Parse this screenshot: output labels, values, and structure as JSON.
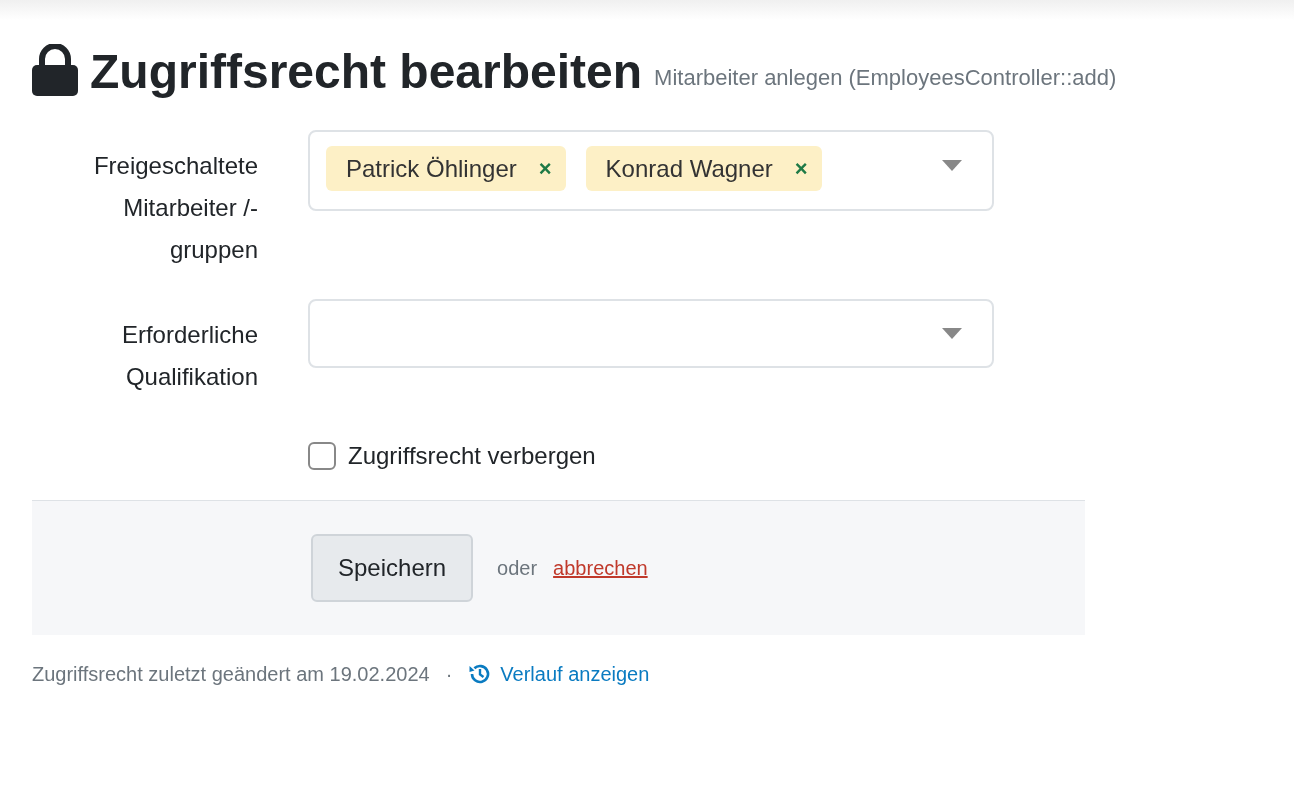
{
  "title": "Zugriffsrecht bearbeiten",
  "subtitle": "Mitarbeiter anlegen (EmployeesController::add)",
  "fields": [
    {
      "kind": "multiselect",
      "label": "Freigeschaltete Mitarbeiter /-gruppen",
      "tags": [
        {
          "text": "Patrick Öhlinger",
          "remove": "×"
        },
        {
          "text": "Konrad Wagner",
          "remove": "×"
        }
      ]
    },
    {
      "kind": "select",
      "label": "Erforderliche Qualifikation"
    }
  ],
  "checkbox": {
    "label": "Zugriffsrecht verbergen",
    "checked": false
  },
  "actions": {
    "save": "Speichern",
    "separator": "oder",
    "cancel": "abbrechen"
  },
  "footer": {
    "text": "Zugriffsrecht zuletzt geändert am 19.02.2024",
    "dot": "·",
    "link": "Verlauf anzeigen"
  }
}
